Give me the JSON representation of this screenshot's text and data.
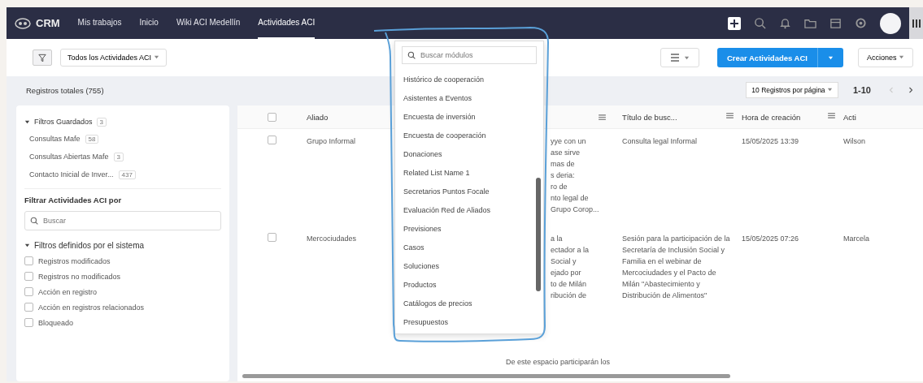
{
  "nav": {
    "logo": "CRM",
    "items": [
      {
        "label": "Mis trabajos",
        "selected": false
      },
      {
        "label": "Inicio",
        "selected": false
      },
      {
        "label": "Wiki ACI Medellín",
        "selected": false
      },
      {
        "label": "Actividades ACI",
        "selected": true
      }
    ]
  },
  "toolbar": {
    "view": "Todos los Actividades ACI",
    "create": "Crear Actividades ACI",
    "actions": "Acciones"
  },
  "summary": {
    "total": "Registros totales (755)",
    "per_page": "10 Registros por página",
    "range": "1-10"
  },
  "saved_filters": {
    "title": "Filtros Guardados",
    "count": "3",
    "expanded": true,
    "items": [
      {
        "label": "Consultas Mafe",
        "count": "58"
      },
      {
        "label": "Consultas Abiertas Mafe",
        "count": "3"
      },
      {
        "label": "Contacto Inicial de Inver...",
        "count": "437"
      }
    ]
  },
  "filter_by": {
    "title": "Filtrar Actividades ACI por",
    "placeholder": "Buscar"
  },
  "system_filters": {
    "title": "Filtros definidos por el sistema",
    "expanded": true,
    "items": [
      {
        "label": "Registros modificados",
        "checked": false
      },
      {
        "label": "Registros no modificados",
        "checked": false
      },
      {
        "label": "Acción en registro",
        "checked": false
      },
      {
        "label": "Acción en registros relacionados",
        "checked": false
      },
      {
        "label": "Bloqueado",
        "checked": false
      }
    ]
  },
  "table": {
    "select_all_checked": false,
    "columns": [
      "Aliado",
      "Título de busc...",
      "Hora de creación",
      "Acti"
    ],
    "rows": [
      {
        "checked": false,
        "aliado": "Grupo Informal",
        "desc": [
          "yye con un",
          "ase sirve",
          "mas de",
          "s deria:",
          "ro de",
          "nto legal de",
          "Grupo Corop..."
        ],
        "titulo": "Consulta legal Informal",
        "hora": "15/05/2025 13:39",
        "acti": "Wilson"
      },
      {
        "checked": false,
        "aliado": "Mercociudades",
        "desc": [
          "a la",
          "ectador a la",
          "Social y",
          "ejado por",
          "to de Milán",
          "ribución de"
        ],
        "titulo": "Sesión para la participación de la Secretaría de Inclusión Social y Familia en el webinar de Mercociudades y el Pacto de Milán \"Abastecimiento y Distribución de Alimentos\"",
        "hora": "15/05/2025 07:26",
        "acti": "Marcela"
      }
    ],
    "partial_row": "De este espacio participarán los"
  },
  "module_menu": {
    "placeholder": "Buscar módulos",
    "items": [
      "Histórico de cooperación",
      "Asistentes a Eventos",
      "Encuesta de inversión",
      "Encuesta de cooperación",
      "Donaciones",
      "Related List Name 1",
      "Secretarios Puntos Focale",
      "Evaluación Red de Aliados",
      "Previsiones",
      "Casos",
      "Soluciones",
      "Productos",
      "Catálogos de precios",
      "Presupuestos"
    ]
  }
}
